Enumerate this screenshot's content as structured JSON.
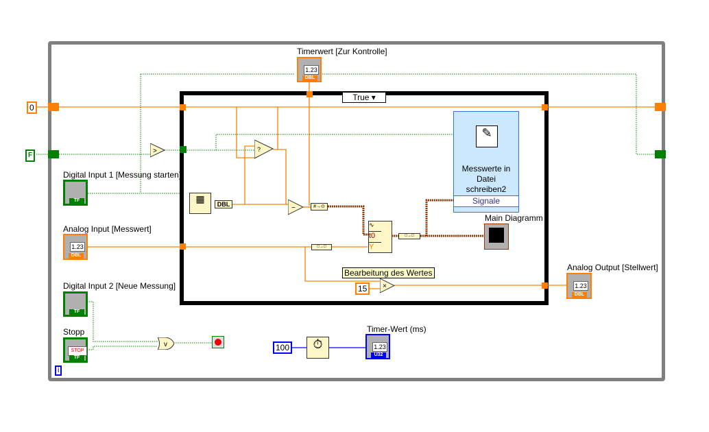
{
  "case_structure": {
    "selector": "True"
  },
  "constants": {
    "initial_value": "0",
    "initial_bool": "F",
    "factor": "15",
    "wait_ms": "100",
    "iteration": "i"
  },
  "labels": {
    "timerwert": "Timerwert [Zur Kontrolle]",
    "digital_input_1": "Digital Input 1 [Messung starten]",
    "analog_input": "Analog Input [Messwert]",
    "digital_input_2": "Digital Input 2 [Neue Messung]",
    "stopp": "Stopp",
    "main_diagramm": "Main Diagramm",
    "analog_output": "Analog Output [Stellwert]",
    "timer_wert": "Timer-Wert (ms)",
    "bearbeitung": "Bearbeitung des Wertes"
  },
  "express_vi": {
    "title_lines": [
      "Messwerte in",
      "Datei",
      "schreiben2"
    ],
    "terminal": "Signale"
  },
  "terminals": {
    "num_display": "1.23",
    "dbl_tag": "DBL",
    "u32_tag": "U32",
    "bool_tag": "TF",
    "stop_text": "STOP",
    "dbl_conv": "DBL",
    "build_wf_t0": "t0",
    "build_wf_y": "Y"
  },
  "colors": {
    "numeric_dbl": "#ff8000",
    "boolean": "#008000",
    "integer": "#0000ff",
    "waveform": "#993300",
    "loop_border": "#808080",
    "express_vi": "#cce8ff"
  }
}
